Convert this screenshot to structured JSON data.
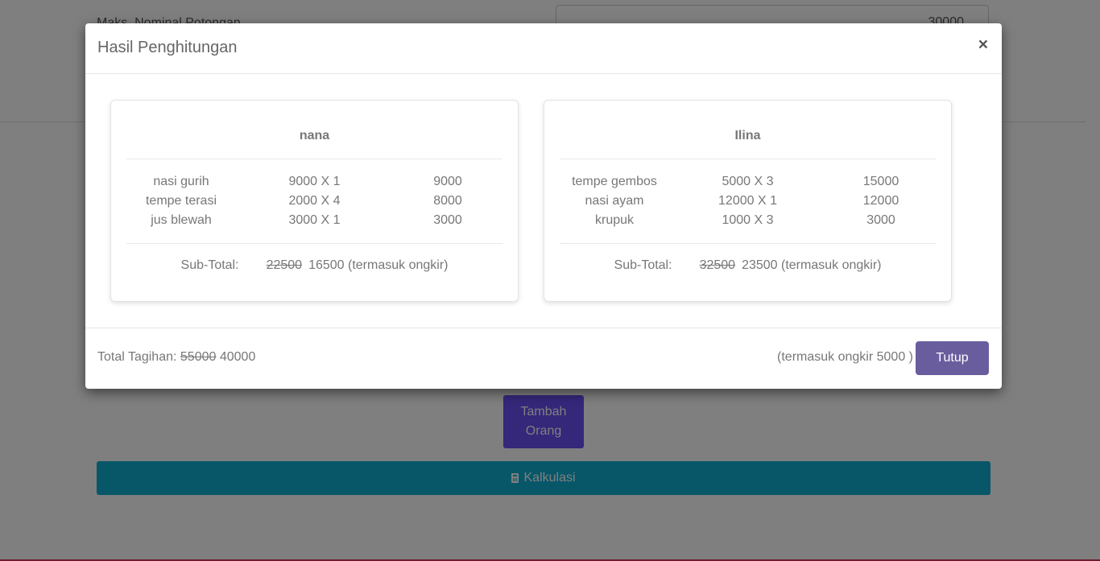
{
  "background": {
    "max_discount_label": "Maks. Nominal Potongan",
    "max_discount_value": "30000",
    "add_person_button": "Tambah Orang",
    "calculate_button": "Kalkulasi"
  },
  "modal": {
    "title": "Hasil Penghitungan",
    "close_symbol": "×",
    "people": [
      {
        "name": "nana",
        "items": [
          {
            "name": "nasi gurih",
            "qty": "9000 X 1",
            "total": "9000"
          },
          {
            "name": "tempe terasi",
            "qty": "2000 X 4",
            "total": "8000"
          },
          {
            "name": "jus blewah",
            "qty": "3000 X 1",
            "total": "3000"
          }
        ],
        "subtotal_label": "Sub-Total:",
        "subtotal_old": "22500",
        "subtotal_new": "16500 (termasuk ongkir)"
      },
      {
        "name": "Ilina",
        "items": [
          {
            "name": "tempe gembos",
            "qty": "5000 X 3",
            "total": "15000"
          },
          {
            "name": "nasi ayam",
            "qty": "12000 X 1",
            "total": "12000"
          },
          {
            "name": "krupuk",
            "qty": "1000 X 3",
            "total": "3000"
          }
        ],
        "subtotal_label": "Sub-Total:",
        "subtotal_old": "32500",
        "subtotal_new": "23500 (termasuk ongkir)"
      }
    ],
    "footer": {
      "total_label": "Total Tagihan:",
      "total_old": "55000",
      "total_new": "40000",
      "ongkir_note": "(termasuk ongkir 5000 )",
      "close_button": "Tutup"
    }
  },
  "colors": {
    "add_button": "#6a4ff5",
    "calc_button": "#0faed3",
    "close_button": "#6a5d9e"
  }
}
